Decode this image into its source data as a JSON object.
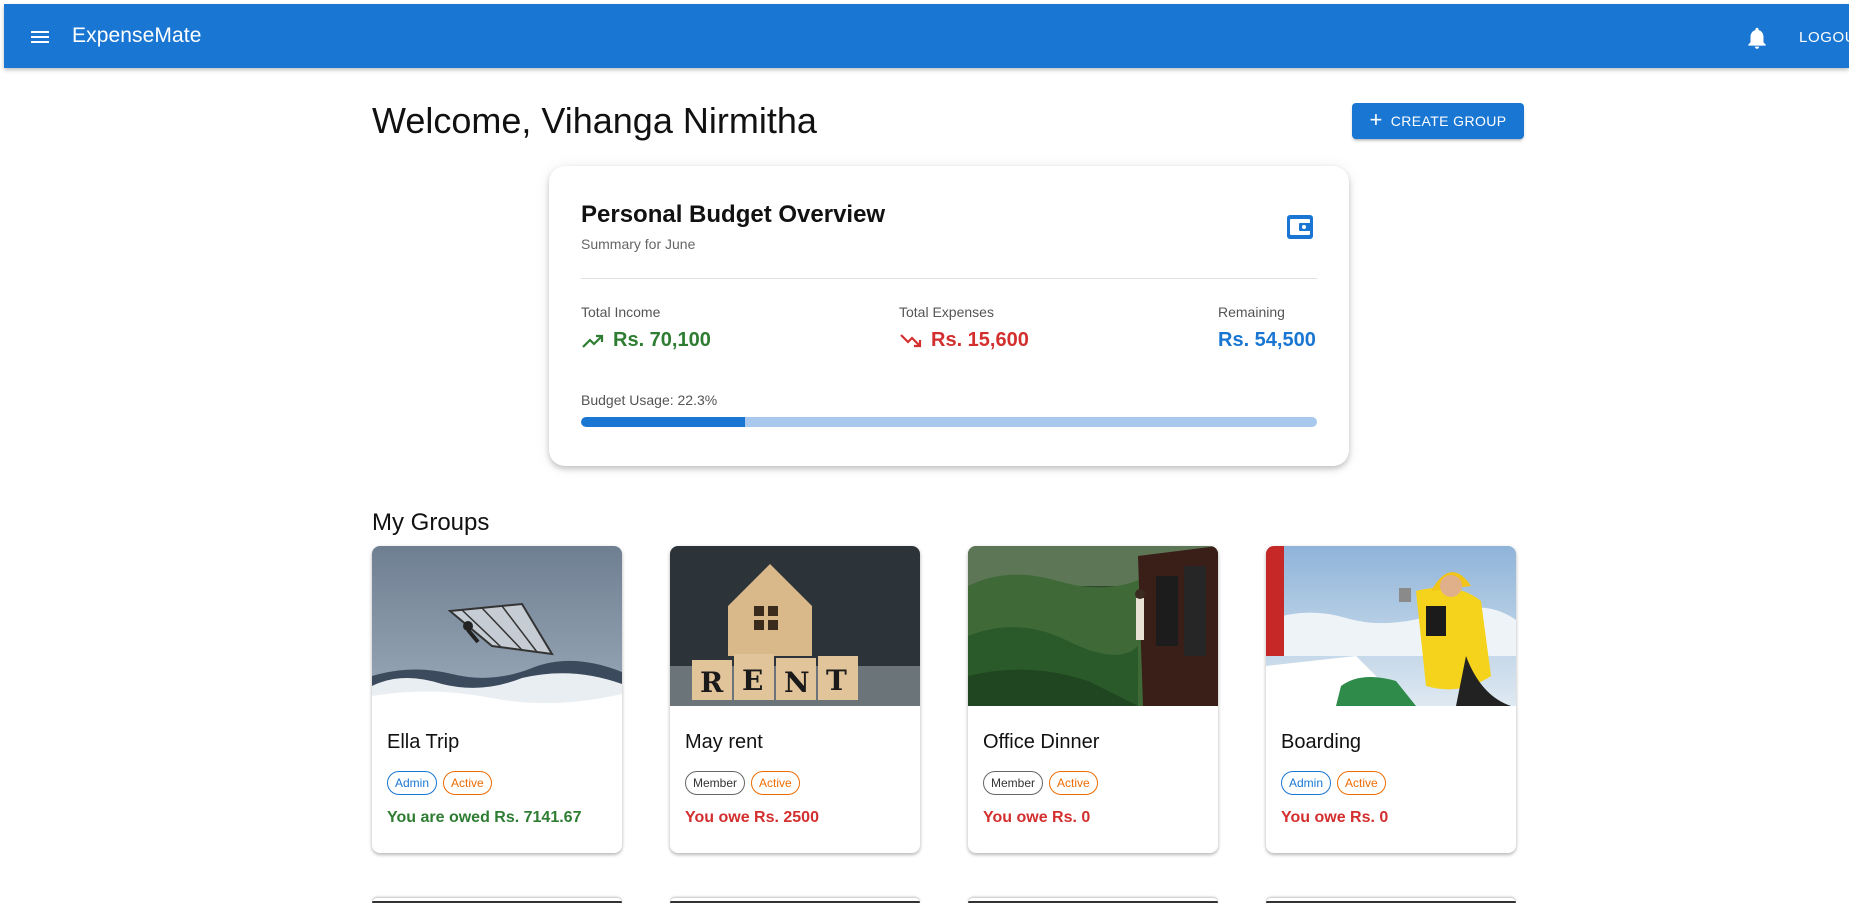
{
  "app": {
    "title": "ExpenseMate",
    "logout_label": "LOGOUT"
  },
  "header": {
    "welcome": "Welcome, Vihanga Nirmitha",
    "create_group_label": "CREATE GROUP"
  },
  "budget": {
    "title": "Personal Budget Overview",
    "subtitle": "Summary for June",
    "income_label": "Total Income",
    "income_value": "Rs. 70,100",
    "expenses_label": "Total Expenses",
    "expenses_value": "Rs. 15,600",
    "remaining_label": "Remaining",
    "remaining_value": "Rs. 54,500",
    "usage_label": "Budget Usage: 22.3%",
    "usage_percent": 22.3
  },
  "groups": {
    "title": "My Groups",
    "items": [
      {
        "name": "Ella Trip",
        "role": "Admin",
        "status": "Active",
        "balance": "You are owed Rs. 7141.67",
        "balance_type": "positive",
        "image": "windsurfer-photo"
      },
      {
        "name": "May rent",
        "role": "Member",
        "status": "Active",
        "balance": "You owe Rs. 2500",
        "balance_type": "negative",
        "image": "rent-blocks-photo"
      },
      {
        "name": "Office Dinner",
        "role": "Member",
        "status": "Active",
        "balance": "You owe Rs. 0",
        "balance_type": "negative",
        "image": "train-hillside-photo"
      },
      {
        "name": "Boarding",
        "role": "Admin",
        "status": "Active",
        "balance": "You owe Rs. 0",
        "balance_type": "negative",
        "image": "mountaineer-photo"
      }
    ]
  },
  "colors": {
    "primary": "#1976d2",
    "positive": "#2e7d32",
    "negative": "#d32f2f",
    "active_tag": "#ed6c02"
  },
  "icons": {
    "menu": "menu-icon",
    "notifications": "bell-icon",
    "add": "plus-icon",
    "wallet": "wallet-icon",
    "trending_up": "trending-up-icon",
    "trending_down": "trending-down-icon"
  }
}
